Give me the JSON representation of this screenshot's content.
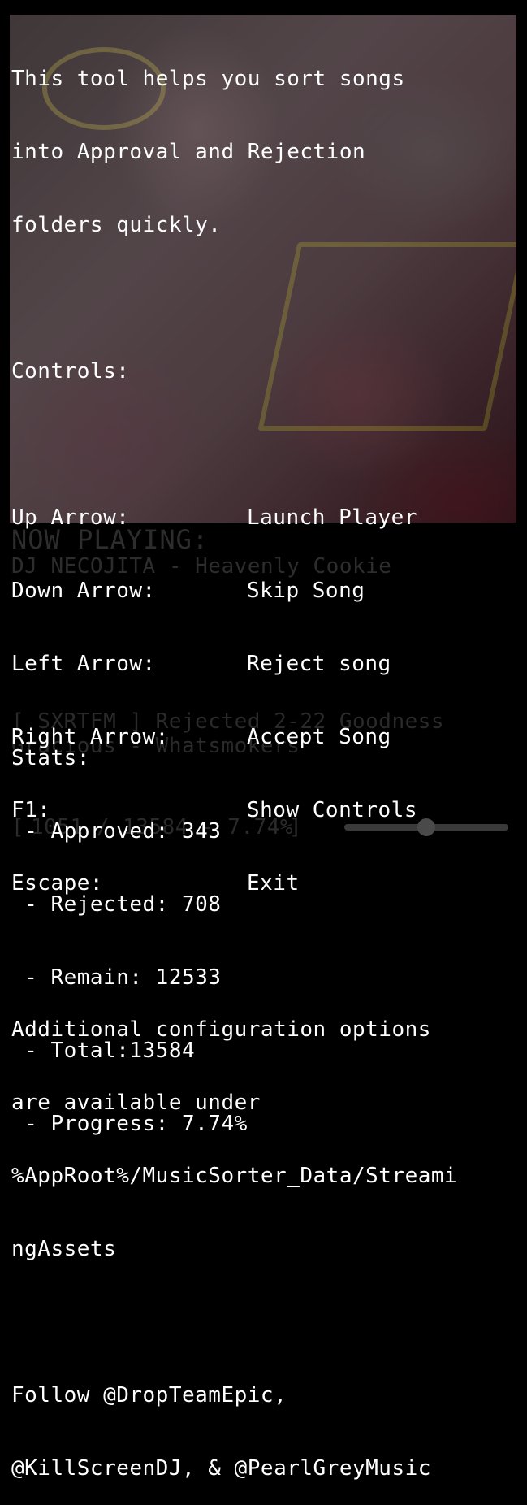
{
  "help": {
    "intro": [
      "This tool helps you sort songs",
      "into Approval and Rejection",
      "folders quickly."
    ],
    "controls_heading": "Controls:",
    "controls": [
      {
        "key": "Up Arrow:",
        "action": "Launch Player"
      },
      {
        "key": "Down Arrow:",
        "action": "Skip Song"
      },
      {
        "key": "Left Arrow:",
        "action": "Reject song"
      },
      {
        "key": "Right Arrow:",
        "action": "Accept Song"
      },
      {
        "key": "F1:",
        "action": "Show Controls"
      },
      {
        "key": "Escape:",
        "action": "Exit"
      }
    ],
    "config": [
      "Additional configuration options",
      "are available under",
      "%AppRoot%/MusicSorter_Data/Streami",
      "ngAssets"
    ],
    "follow": [
      "Follow @DropTeamEpic,",
      "@KillScreenDJ, & @PearlGreyMusic"
    ]
  },
  "now_playing": {
    "label": "NOW PLAYING:",
    "track": "DJ NECOJITA - Heavenly Cookie"
  },
  "last_action": {
    "line1": "[ SXRTFM ] Rejected 2-22 Goodness",
    "line2": "Gracious - Whatsmokers"
  },
  "counter": {
    "open": "[",
    "value": "1051 / 13584 - 7.74%",
    "close": "]"
  },
  "stats": {
    "heading": "Stats:",
    "approved": " - Approved: 343",
    "rejected": " - Rejected: 708",
    "remain": " - Remain: 12533",
    "total": " - Total:13584",
    "progress": " - Progress: 7.74%"
  },
  "volume": {
    "level": 0.5
  },
  "colors": {
    "background": "#000000",
    "text": "#ffffff",
    "dim_text": "#2d2d2d"
  }
}
